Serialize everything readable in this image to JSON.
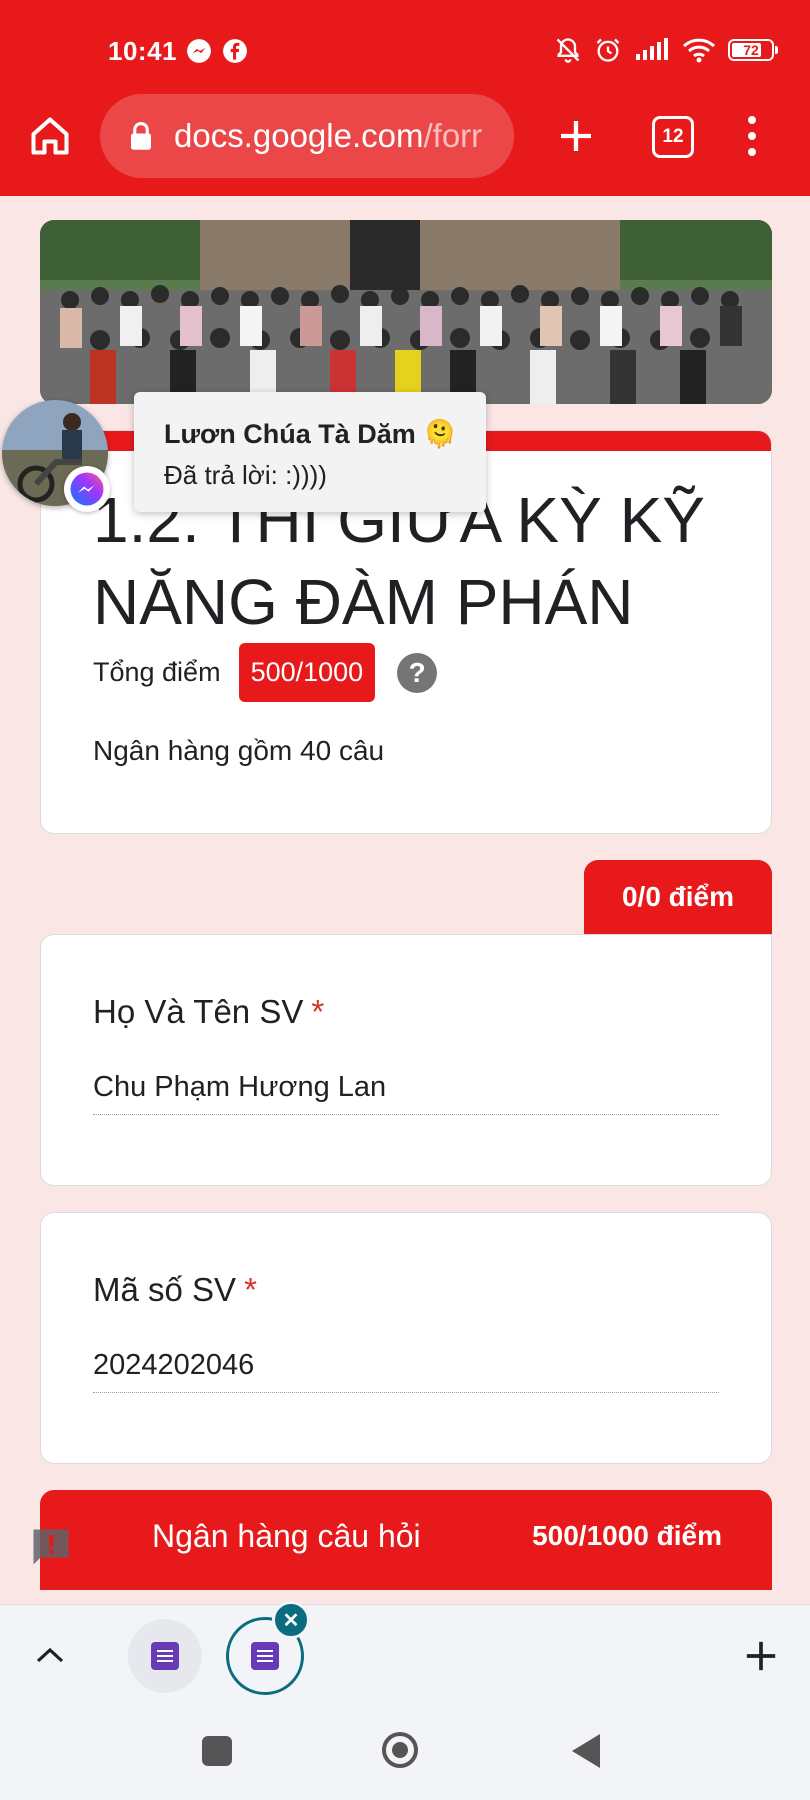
{
  "status_bar": {
    "time": "10:41",
    "battery": "72"
  },
  "browser": {
    "url_domain": "docs.google.com",
    "url_path": "/forr",
    "tab_count": "12"
  },
  "chat_bubble": {
    "sender": "Lươn Chúa Tà Dăm 🫠",
    "message": "Đã trả lời: :))))"
  },
  "form": {
    "title": "1.2. THI GIỮA KỲ KỸ NĂNG ĐÀM PHÁN",
    "total_label": "Tổng điểm",
    "total_score": "500/1000",
    "help": "?",
    "description": "Ngân hàng gồm 40 câu",
    "points_tab": "0/0 điểm",
    "questions": [
      {
        "label": "Họ Và Tên SV",
        "required": "*",
        "answer": "Chu Phạm Hương Lan"
      },
      {
        "label": "Mã số SV",
        "required": "*",
        "answer": "2024202046"
      }
    ],
    "section": {
      "title": "Ngân hàng câu hỏi",
      "points": "500/1000 điểm"
    }
  },
  "colors": {
    "brand_red": "#e8191b",
    "forms_purple": "#673ab7",
    "teal": "#0b6c80"
  }
}
